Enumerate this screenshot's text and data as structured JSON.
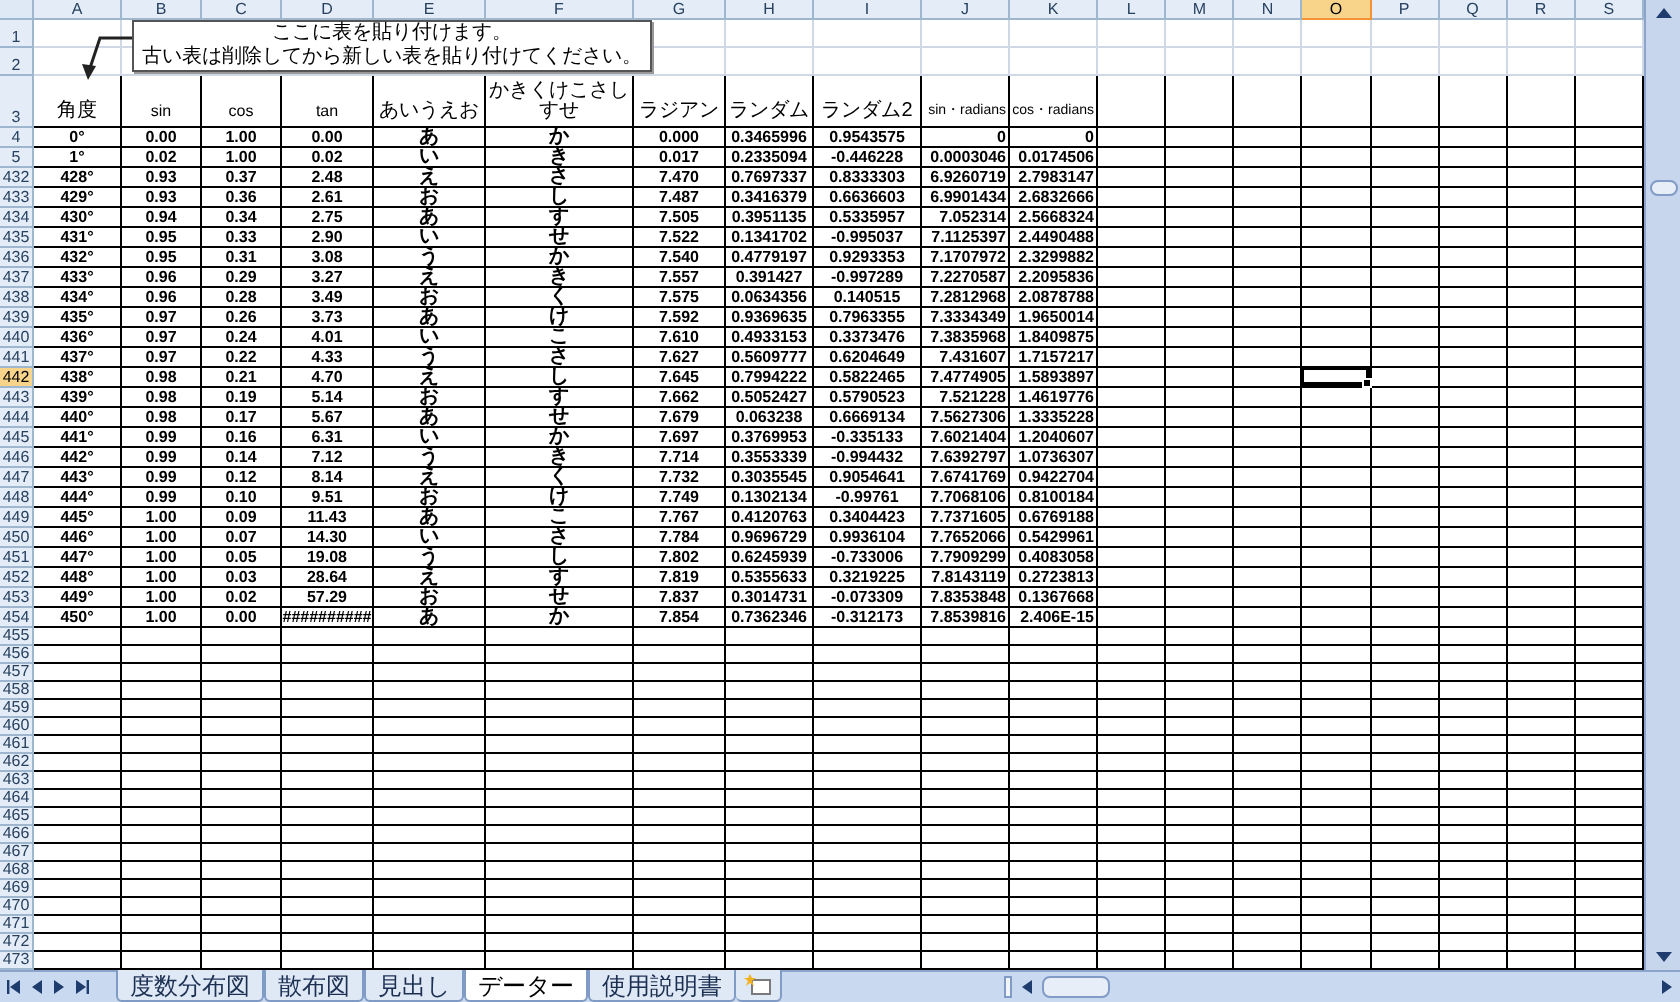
{
  "sheet": {
    "column_headers": [
      {
        "label": "A",
        "selected": false
      },
      {
        "label": "B",
        "selected": false
      },
      {
        "label": "C",
        "selected": false
      },
      {
        "label": "D",
        "selected": false
      },
      {
        "label": "E",
        "selected": false
      },
      {
        "label": "F",
        "selected": false
      },
      {
        "label": "G",
        "selected": false
      },
      {
        "label": "H",
        "selected": false
      },
      {
        "label": "I",
        "selected": false
      },
      {
        "label": "J",
        "selected": false
      },
      {
        "label": "K",
        "selected": false
      },
      {
        "label": "L",
        "selected": false
      },
      {
        "label": "M",
        "selected": false
      },
      {
        "label": "N",
        "selected": false
      },
      {
        "label": "O",
        "selected": true
      },
      {
        "label": "P",
        "selected": false
      },
      {
        "label": "Q",
        "selected": false
      },
      {
        "label": "R",
        "selected": false
      },
      {
        "label": "S",
        "selected": false
      }
    ],
    "callout": {
      "lines": [
        "ここに表を貼り付けます。",
        "古い表は削除してから新しい表を貼り付けてください。"
      ]
    },
    "rows": [
      {
        "number": "1",
        "kind": "top",
        "selected": false
      },
      {
        "number": "2",
        "kind": "top",
        "selected": false
      },
      {
        "number": "3",
        "kind": "header",
        "selected": false,
        "cells": [
          "角度",
          "sin",
          "cos",
          "tan",
          "あいうえお",
          "かきくけこさしすせ",
          "ラジアン",
          "ランダム",
          "ランダム2",
          "sin・radians",
          "cos・radians"
        ]
      },
      {
        "number": "4",
        "kind": "data",
        "selected": false,
        "cells": [
          "0°",
          "0.00",
          "1.00",
          "0.00",
          "あ",
          "か",
          "0.000",
          "0.3465996",
          "0.9543575",
          "0",
          "0"
        ]
      },
      {
        "number": "5",
        "kind": "data",
        "selected": false,
        "cells": [
          "1°",
          "0.02",
          "1.00",
          "0.02",
          "い",
          "き",
          "0.017",
          "0.2335094",
          "-0.446228",
          "0.0003046",
          "0.0174506"
        ]
      },
      {
        "number": "432",
        "kind": "data",
        "selected": false,
        "cells": [
          "428°",
          "0.93",
          "0.37",
          "2.48",
          "え",
          "さ",
          "7.470",
          "0.7697337",
          "0.8333303",
          "6.9260719",
          "2.7983147"
        ]
      },
      {
        "number": "433",
        "kind": "data",
        "selected": false,
        "cells": [
          "429°",
          "0.93",
          "0.36",
          "2.61",
          "お",
          "し",
          "7.487",
          "0.3416379",
          "0.6636603",
          "6.9901434",
          "2.6832666"
        ]
      },
      {
        "number": "434",
        "kind": "data",
        "selected": false,
        "cells": [
          "430°",
          "0.94",
          "0.34",
          "2.75",
          "あ",
          "す",
          "7.505",
          "0.3951135",
          "0.5335957",
          "7.052314",
          "2.5668324"
        ]
      },
      {
        "number": "435",
        "kind": "data",
        "selected": false,
        "cells": [
          "431°",
          "0.95",
          "0.33",
          "2.90",
          "い",
          "せ",
          "7.522",
          "0.1341702",
          "-0.995037",
          "7.1125397",
          "2.4490488"
        ]
      },
      {
        "number": "436",
        "kind": "data",
        "selected": false,
        "cells": [
          "432°",
          "0.95",
          "0.31",
          "3.08",
          "う",
          "か",
          "7.540",
          "0.4779197",
          "0.9293353",
          "7.1707972",
          "2.3299882"
        ]
      },
      {
        "number": "437",
        "kind": "data",
        "selected": false,
        "cells": [
          "433°",
          "0.96",
          "0.29",
          "3.27",
          "え",
          "き",
          "7.557",
          "0.391427",
          "-0.997289",
          "7.2270587",
          "2.2095836"
        ]
      },
      {
        "number": "438",
        "kind": "data",
        "selected": false,
        "cells": [
          "434°",
          "0.96",
          "0.28",
          "3.49",
          "お",
          "く",
          "7.575",
          "0.0634356",
          "0.140515",
          "7.2812968",
          "2.0878788"
        ]
      },
      {
        "number": "439",
        "kind": "data",
        "selected": false,
        "cells": [
          "435°",
          "0.97",
          "0.26",
          "3.73",
          "あ",
          "け",
          "7.592",
          "0.9369635",
          "0.7963355",
          "7.3334349",
          "1.9650014"
        ]
      },
      {
        "number": "440",
        "kind": "data",
        "selected": false,
        "cells": [
          "436°",
          "0.97",
          "0.24",
          "4.01",
          "い",
          "こ",
          "7.610",
          "0.4933153",
          "0.3373476",
          "7.3835968",
          "1.8409875"
        ]
      },
      {
        "number": "441",
        "kind": "data",
        "selected": false,
        "cells": [
          "437°",
          "0.97",
          "0.22",
          "4.33",
          "う",
          "さ",
          "7.627",
          "0.5609777",
          "0.6204649",
          "7.431607",
          "1.7157217"
        ]
      },
      {
        "number": "442",
        "kind": "data",
        "selected": true,
        "cells": [
          "438°",
          "0.98",
          "0.21",
          "4.70",
          "え",
          "し",
          "7.645",
          "0.7994222",
          "0.5822465",
          "7.4774905",
          "1.5893897"
        ]
      },
      {
        "number": "443",
        "kind": "data",
        "selected": false,
        "cells": [
          "439°",
          "0.98",
          "0.19",
          "5.14",
          "お",
          "す",
          "7.662",
          "0.5052427",
          "0.5790523",
          "7.521228",
          "1.4619776"
        ]
      },
      {
        "number": "444",
        "kind": "data",
        "selected": false,
        "cells": [
          "440°",
          "0.98",
          "0.17",
          "5.67",
          "あ",
          "せ",
          "7.679",
          "0.063238",
          "0.6669134",
          "7.5627306",
          "1.3335228"
        ]
      },
      {
        "number": "445",
        "kind": "data",
        "selected": false,
        "cells": [
          "441°",
          "0.99",
          "0.16",
          "6.31",
          "い",
          "か",
          "7.697",
          "0.3769953",
          "-0.335133",
          "7.6021404",
          "1.2040607"
        ]
      },
      {
        "number": "446",
        "kind": "data",
        "selected": false,
        "cells": [
          "442°",
          "0.99",
          "0.14",
          "7.12",
          "う",
          "き",
          "7.714",
          "0.3553339",
          "-0.994432",
          "7.6392797",
          "1.0736307"
        ]
      },
      {
        "number": "447",
        "kind": "data",
        "selected": false,
        "cells": [
          "443°",
          "0.99",
          "0.12",
          "8.14",
          "え",
          "く",
          "7.732",
          "0.3035545",
          "0.9054641",
          "7.6741769",
          "0.9422704"
        ]
      },
      {
        "number": "448",
        "kind": "data",
        "selected": false,
        "cells": [
          "444°",
          "0.99",
          "0.10",
          "9.51",
          "お",
          "け",
          "7.749",
          "0.1302134",
          "-0.99761",
          "7.7068106",
          "0.8100184"
        ]
      },
      {
        "number": "449",
        "kind": "data",
        "selected": false,
        "cells": [
          "445°",
          "1.00",
          "0.09",
          "11.43",
          "あ",
          "こ",
          "7.767",
          "0.4120763",
          "0.3404423",
          "7.7371605",
          "0.6769188"
        ]
      },
      {
        "number": "450",
        "kind": "data",
        "selected": false,
        "cells": [
          "446°",
          "1.00",
          "0.07",
          "14.30",
          "い",
          "さ",
          "7.784",
          "0.9696729",
          "0.9936104",
          "7.7652066",
          "0.5429961"
        ]
      },
      {
        "number": "451",
        "kind": "data",
        "selected": false,
        "cells": [
          "447°",
          "1.00",
          "0.05",
          "19.08",
          "う",
          "し",
          "7.802",
          "0.6245939",
          "-0.733006",
          "7.7909299",
          "0.4083058"
        ]
      },
      {
        "number": "452",
        "kind": "data",
        "selected": false,
        "cells": [
          "448°",
          "1.00",
          "0.03",
          "28.64",
          "え",
          "す",
          "7.819",
          "0.5355633",
          "0.3219225",
          "7.8143119",
          "0.2723813"
        ]
      },
      {
        "number": "453",
        "kind": "data",
        "selected": false,
        "cells": [
          "449°",
          "1.00",
          "0.02",
          "57.29",
          "お",
          "せ",
          "7.837",
          "0.3014731",
          "-0.073309",
          "7.8353848",
          "0.1367668"
        ]
      },
      {
        "number": "454",
        "kind": "data",
        "selected": false,
        "cells": [
          "450°",
          "1.00",
          "0.00",
          "##########",
          "あ",
          "か",
          "7.854",
          "0.7362346",
          "-0.312173",
          "7.8539816",
          "2.406E-15"
        ]
      },
      {
        "number": "455",
        "kind": "blank",
        "selected": false
      },
      {
        "number": "456",
        "kind": "blank",
        "selected": false
      },
      {
        "number": "457",
        "kind": "blank",
        "selected": false
      },
      {
        "number": "458",
        "kind": "blank",
        "selected": false
      },
      {
        "number": "459",
        "kind": "blank",
        "selected": false
      },
      {
        "number": "460",
        "kind": "blank",
        "selected": false
      },
      {
        "number": "461",
        "kind": "blank",
        "selected": false
      },
      {
        "number": "462",
        "kind": "blank",
        "selected": false
      },
      {
        "number": "463",
        "kind": "blank",
        "selected": false
      },
      {
        "number": "464",
        "kind": "blank",
        "selected": false
      },
      {
        "number": "465",
        "kind": "blank",
        "selected": false
      },
      {
        "number": "466",
        "kind": "blank",
        "selected": false
      },
      {
        "number": "467",
        "kind": "blank",
        "selected": false
      },
      {
        "number": "468",
        "kind": "blank",
        "selected": false
      },
      {
        "number": "469",
        "kind": "blank",
        "selected": false
      },
      {
        "number": "470",
        "kind": "blank",
        "selected": false
      },
      {
        "number": "471",
        "kind": "blank",
        "selected": false
      },
      {
        "number": "472",
        "kind": "blank",
        "selected": false
      },
      {
        "number": "473",
        "kind": "blank",
        "selected": false
      }
    ]
  },
  "sheet_tabs": [
    {
      "label": "度数分布図",
      "selected": false
    },
    {
      "label": "散布図",
      "selected": false
    },
    {
      "label": "見出し",
      "selected": false
    },
    {
      "label": "データー",
      "selected": true
    },
    {
      "label": "使用説明書",
      "selected": false
    }
  ]
}
